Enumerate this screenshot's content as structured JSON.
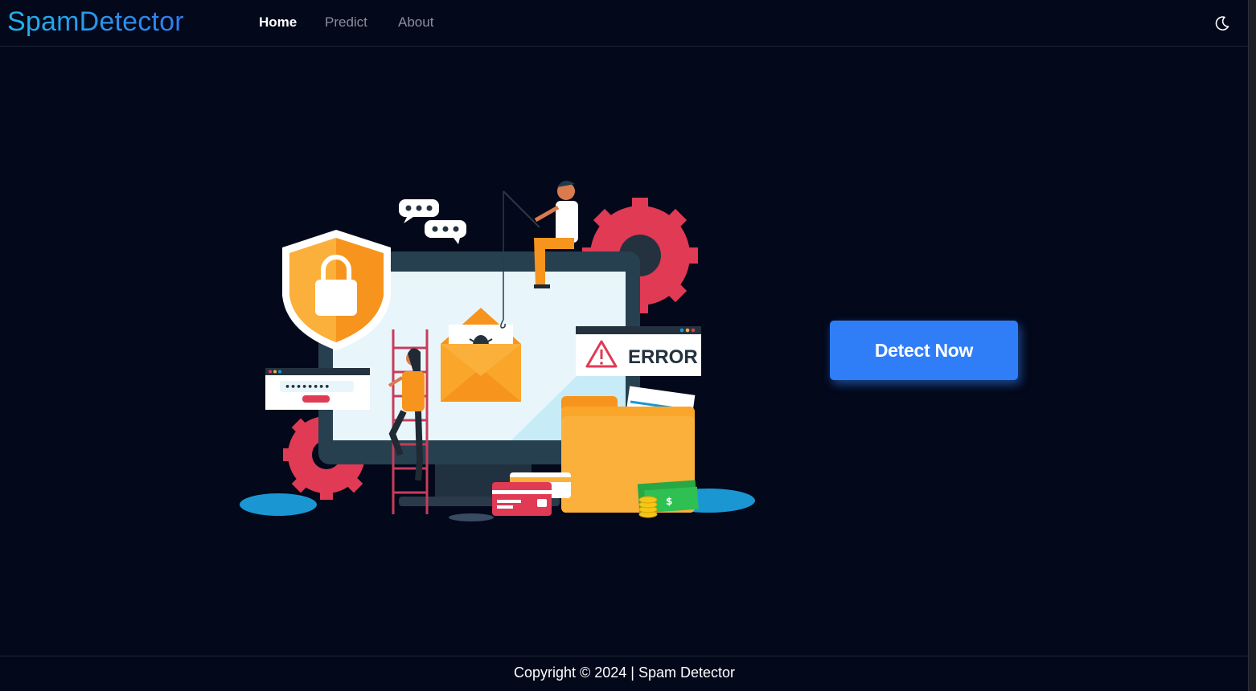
{
  "navbar": {
    "brand": "SpamDetector",
    "links": [
      {
        "label": "Home",
        "active": true
      },
      {
        "label": "Predict",
        "active": false
      },
      {
        "label": "About",
        "active": false
      }
    ],
    "theme_toggle_icon": "moon-icon"
  },
  "hero": {
    "illustration": {
      "error_label": "ERROR",
      "password_mask": "••••••••",
      "money_symbol": "$"
    },
    "cta_label": "Detect Now"
  },
  "footer": {
    "text": "Copyright © 2024 | Spam Detector"
  },
  "colors": {
    "background": "#03081a",
    "accent": "#2f7ef7",
    "brand_gradient_start": "#22b2e8",
    "brand_gradient_end": "#2f7bf0"
  }
}
